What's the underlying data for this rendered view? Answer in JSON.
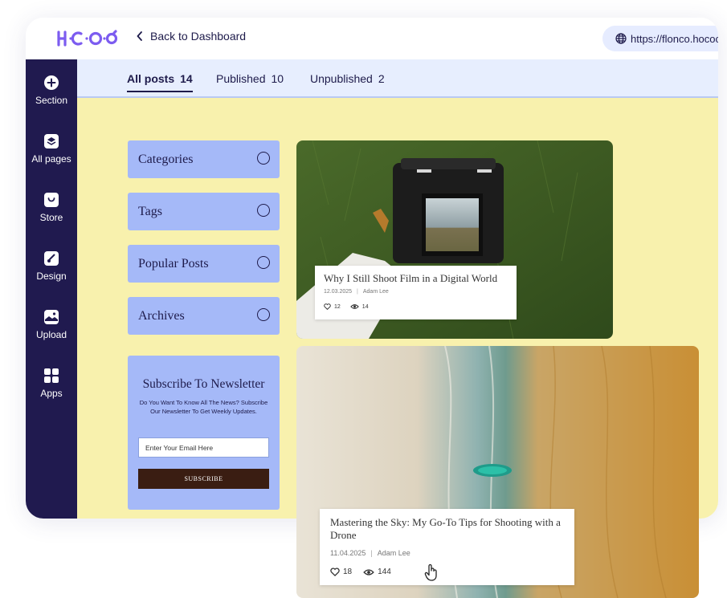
{
  "app": {
    "logo_text": "HoCoO",
    "back_label": "Back to Dashboard",
    "url": "https://flonco.hococ"
  },
  "sidebar": {
    "items": [
      {
        "label": "Section",
        "icon": "plus-circle-icon"
      },
      {
        "label": "All pages",
        "icon": "layers-icon"
      },
      {
        "label": "Store",
        "icon": "shopping-bag-icon"
      },
      {
        "label": "Design",
        "icon": "brush-icon"
      },
      {
        "label": "Upload",
        "icon": "image-upload-icon"
      },
      {
        "label": "Apps",
        "icon": "apps-grid-icon"
      }
    ]
  },
  "tabs": [
    {
      "label": "All posts",
      "count": "14",
      "active": true
    },
    {
      "label": "Published",
      "count": "10",
      "active": false
    },
    {
      "label": "Unpublished",
      "count": "2",
      "active": false
    }
  ],
  "widgets": [
    {
      "label": "Categories"
    },
    {
      "label": "Tags"
    },
    {
      "label": "Popular Posts"
    },
    {
      "label": "Archives"
    }
  ],
  "newsletter": {
    "title": "Subscribe To Newsletter",
    "description": "Do You Want To Know All The News? Subscribe Our Newsletter To Get Weekly Updates.",
    "email_placeholder": "Enter Your Email Here",
    "button_label": "SUBSCRIBE"
  },
  "posts": [
    {
      "title": "Why I Still Shoot Film in a Digital World",
      "date": "12.03.2025",
      "author": "Adam Lee",
      "likes": "12",
      "views": "14"
    },
    {
      "title": "Mastering the Sky: My Go-To Tips for Shooting with a Drone",
      "date": "11.04.2025",
      "author": "Adam Lee",
      "likes": "18",
      "views": "144"
    }
  ],
  "colors": {
    "sidebar": "#201a4f",
    "accent": "#a5b9f8",
    "content_bg": "#f8f1ad",
    "tabs_bg": "#e7eefe",
    "logo": "#7c5cf0"
  }
}
